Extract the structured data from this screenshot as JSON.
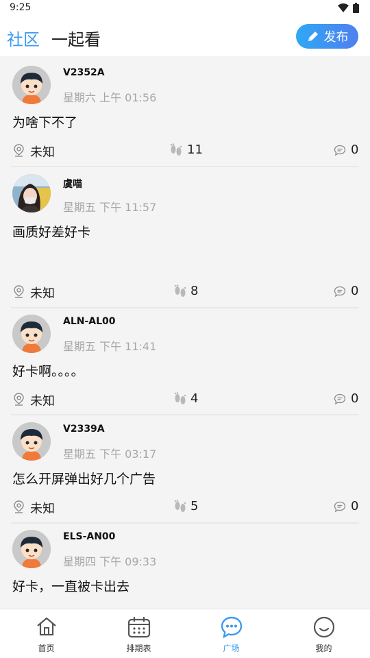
{
  "status_bar": {
    "time": "9:25"
  },
  "header": {
    "tabs": [
      {
        "label": "社区",
        "active": true
      },
      {
        "label": "一起看",
        "active": false
      }
    ],
    "publish_label": "发布"
  },
  "posts": [
    {
      "username": "V2352A",
      "time": "星期六 上午 01:56",
      "content": "为啥下不了",
      "location": "未知",
      "footprints": "11",
      "comments": "0",
      "avatar": "cartoon-boy"
    },
    {
      "username": "虞喵",
      "time": "星期五 下午 11:57",
      "content": "画质好差好卡",
      "location": "未知",
      "footprints": "8",
      "comments": "0",
      "avatar": "photo-girl"
    },
    {
      "username": "ALN-AL00",
      "time": "星期五 下午 11:41",
      "content": "好卡啊。。。。",
      "location": "未知",
      "footprints": "4",
      "comments": "0",
      "avatar": "cartoon-boy"
    },
    {
      "username": "V2339A",
      "time": "星期五 下午 03:17",
      "content": "怎么开屏弹出好几个广告",
      "location": "未知",
      "footprints": "5",
      "comments": "0",
      "avatar": "cartoon-boy"
    },
    {
      "username": "ELS-AN00",
      "time": "星期四 下午 09:33",
      "content": "好卡，一直被卡出去",
      "location": "",
      "footprints": "",
      "comments": "",
      "avatar": "cartoon-boy"
    }
  ],
  "bottom_nav": [
    {
      "label": "首页",
      "icon": "home-icon",
      "active": false
    },
    {
      "label": "排期表",
      "icon": "calendar-icon",
      "active": false
    },
    {
      "label": "广场",
      "icon": "chat-bubble-icon",
      "active": true
    },
    {
      "label": "我的",
      "icon": "smiley-icon",
      "active": false
    }
  ],
  "colors": {
    "accent": "#3b9af0",
    "feed_bg": "#f4f4f4",
    "muted_text": "#a7a7a7"
  }
}
